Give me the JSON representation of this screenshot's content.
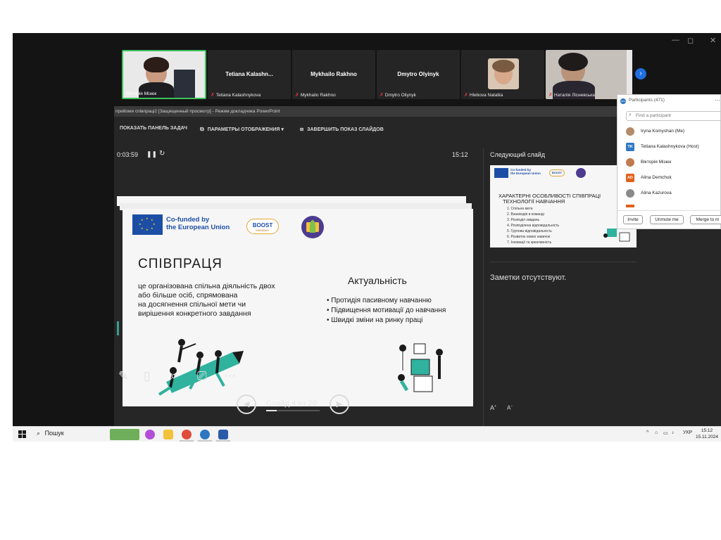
{
  "participants_strip": {
    "tiles": [
      {
        "name": "Вікторія Мізюк",
        "big": ""
      },
      {
        "name": "Tetiana Kalashnykova",
        "big": "Tetiana  Kalashn..."
      },
      {
        "name": "Mykhailo Rakhno",
        "big": "Mykhailo Rakhno"
      },
      {
        "name": "Dmytro Oliynyk",
        "big": "Dmytro Olyinyk"
      },
      {
        "name": "Hlebova Nataliia",
        "big": ""
      },
      {
        "name": "Наталія Лісневська",
        "big": ""
      }
    ]
  },
  "powerpoint": {
    "window_title": "прийоми співпраці2 [Защищенный просмотр] - Режим докладчика PowerPoint",
    "toolbar": {
      "show_taskbar": "ПОКАЗАТЬ ПАНЕЛЬ ЗАДАЧ",
      "display_settings": "ПАРАМЕТРЫ ОТОБРАЖЕНИЯ ▾",
      "end_show": "ЗАВЕРШИТЬ ПОКАЗ СЛАЙДОВ"
    },
    "timer": "0:03:59",
    "clock": "15:12",
    "next_slide_label": "Следующий слайд",
    "notes_text": "Заметки отсутствуют.",
    "slide_counter": "Слайд 4 из 20",
    "current_slide": {
      "logo_text_line1": "Co-funded by",
      "logo_text_line2": "the European Union",
      "boost": "BOOST",
      "boost_sub": "ERASMUS+",
      "title": "СПІВПРАЦЯ",
      "body_lines": [
        "це організована спільна діяльність двох",
        "або більше осіб, спрямована",
        "на досягнення спільної мети чи",
        "вирішення конкретного завдання"
      ],
      "relevance_title": "Актуальність",
      "bullets": [
        "Протидія пасивному навчанню",
        "Підвищення мотивації до навчання",
        "Швидкі зміни на ринку праці"
      ]
    },
    "next_slide": {
      "logo_text_line1": "Co-funded by",
      "logo_text_line2": "the European Union",
      "boost": "BOOST",
      "title_line1": "ХАРАКТЕРНІ ОСОБЛИВОСТІ СПІВПРАЦІ",
      "title_line2": "ТЕХНОЛОГІЇ НАВЧАННЯ",
      "items": [
        "1. Спільна мета",
        "2. Взаємодія в команді",
        "3. Розподіл завдань",
        "4. Розподілена відповідальність",
        "5. Групова відповідальність",
        "6. Розвиток нових навичок",
        "7. Інновації та креативність"
      ]
    }
  },
  "participants_panel": {
    "header": "Participants (471)",
    "search_placeholder": "Find a participant",
    "rows": [
      {
        "initials": "",
        "name": "Iryna Komyshan (Me)",
        "color": "#b58a6a"
      },
      {
        "initials": "TK",
        "name": "Tetiana Kalashnykova (Host)",
        "color": "#2f77c3"
      },
      {
        "initials": "",
        "name": "Вікторія Мізюк",
        "color": "#c07a50"
      },
      {
        "initials": "AD",
        "name": "Alina Demchuk",
        "color": "#e0601a"
      },
      {
        "initials": "",
        "name": "Alina Kazurova",
        "color": "#8a8a8a"
      }
    ],
    "buttons": {
      "invite": "Invite",
      "unmute": "Unmute me",
      "merge": "Merge to m"
    }
  },
  "taskbar": {
    "search_label": "Пошук",
    "language": "УКР",
    "time": "15:12",
    "date": "15.11.2024"
  }
}
